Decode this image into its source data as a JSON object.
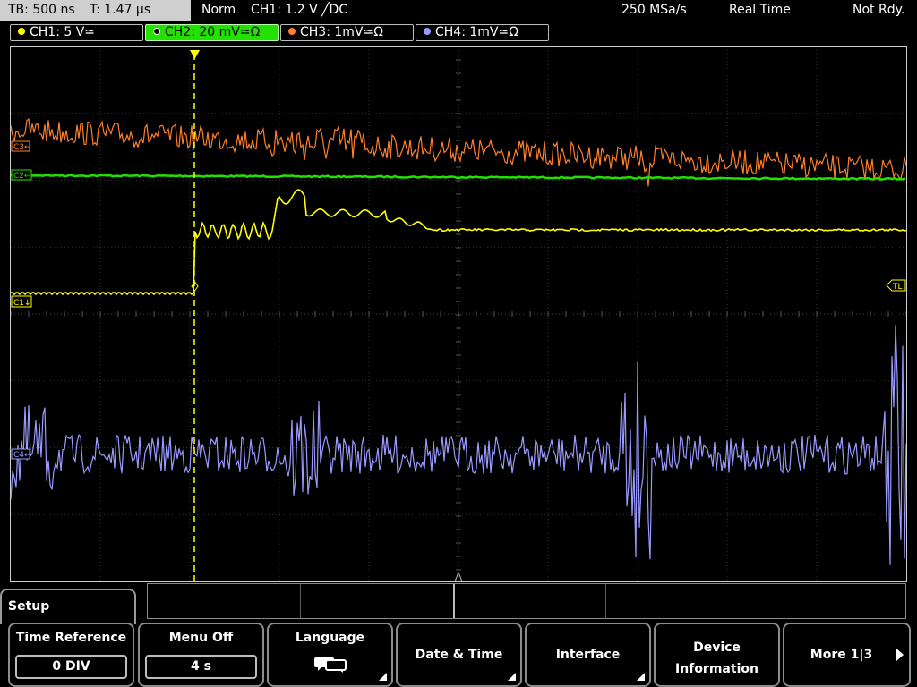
{
  "timebase": {
    "tb": "TB: 500 ns",
    "t": "T: 1.47 µs"
  },
  "status": {
    "mode": "Norm",
    "trigger": "CH1: 1.2 V ╱DC",
    "sample_rate": "250 MSa/s",
    "acq_mode": "Real Time",
    "ready": "Not Rdy."
  },
  "channels": [
    {
      "label": "CH1: 5 V≃",
      "color": "#ffff00",
      "active": false
    },
    {
      "label": "CH2: 20 mV≃Ω",
      "color": "#22e000",
      "active": true
    },
    {
      "label": "CH3: 1mV≃Ω",
      "color": "#ff7f2a",
      "active": false
    },
    {
      "label": "CH4: 1mV≃Ω",
      "color": "#9a9aff",
      "active": false
    }
  ],
  "markers": {
    "c1": "C1↓",
    "c2": "C2←",
    "c3": "C3←",
    "c4": "C4←",
    "tl": "TL",
    "trigger_pos": "T"
  },
  "colors": {
    "ch1": "#ffff00",
    "ch2": "#22e000",
    "ch3": "#ff7f2a",
    "ch4": "#9a9aff",
    "grid": "#3c3c3c",
    "trigger": "#ffff00"
  },
  "menu": {
    "title": "Setup",
    "softkeys": [
      {
        "label": "Time Reference",
        "value": "0 DIV"
      },
      {
        "label": "Menu Off",
        "value": "4 s"
      },
      {
        "label": "Language",
        "icon": "language-icon"
      },
      {
        "label": "Date & Time"
      },
      {
        "label": "Interface"
      },
      {
        "label1": "Device",
        "label2": "Information"
      },
      {
        "label": "More 1|3"
      }
    ]
  }
}
